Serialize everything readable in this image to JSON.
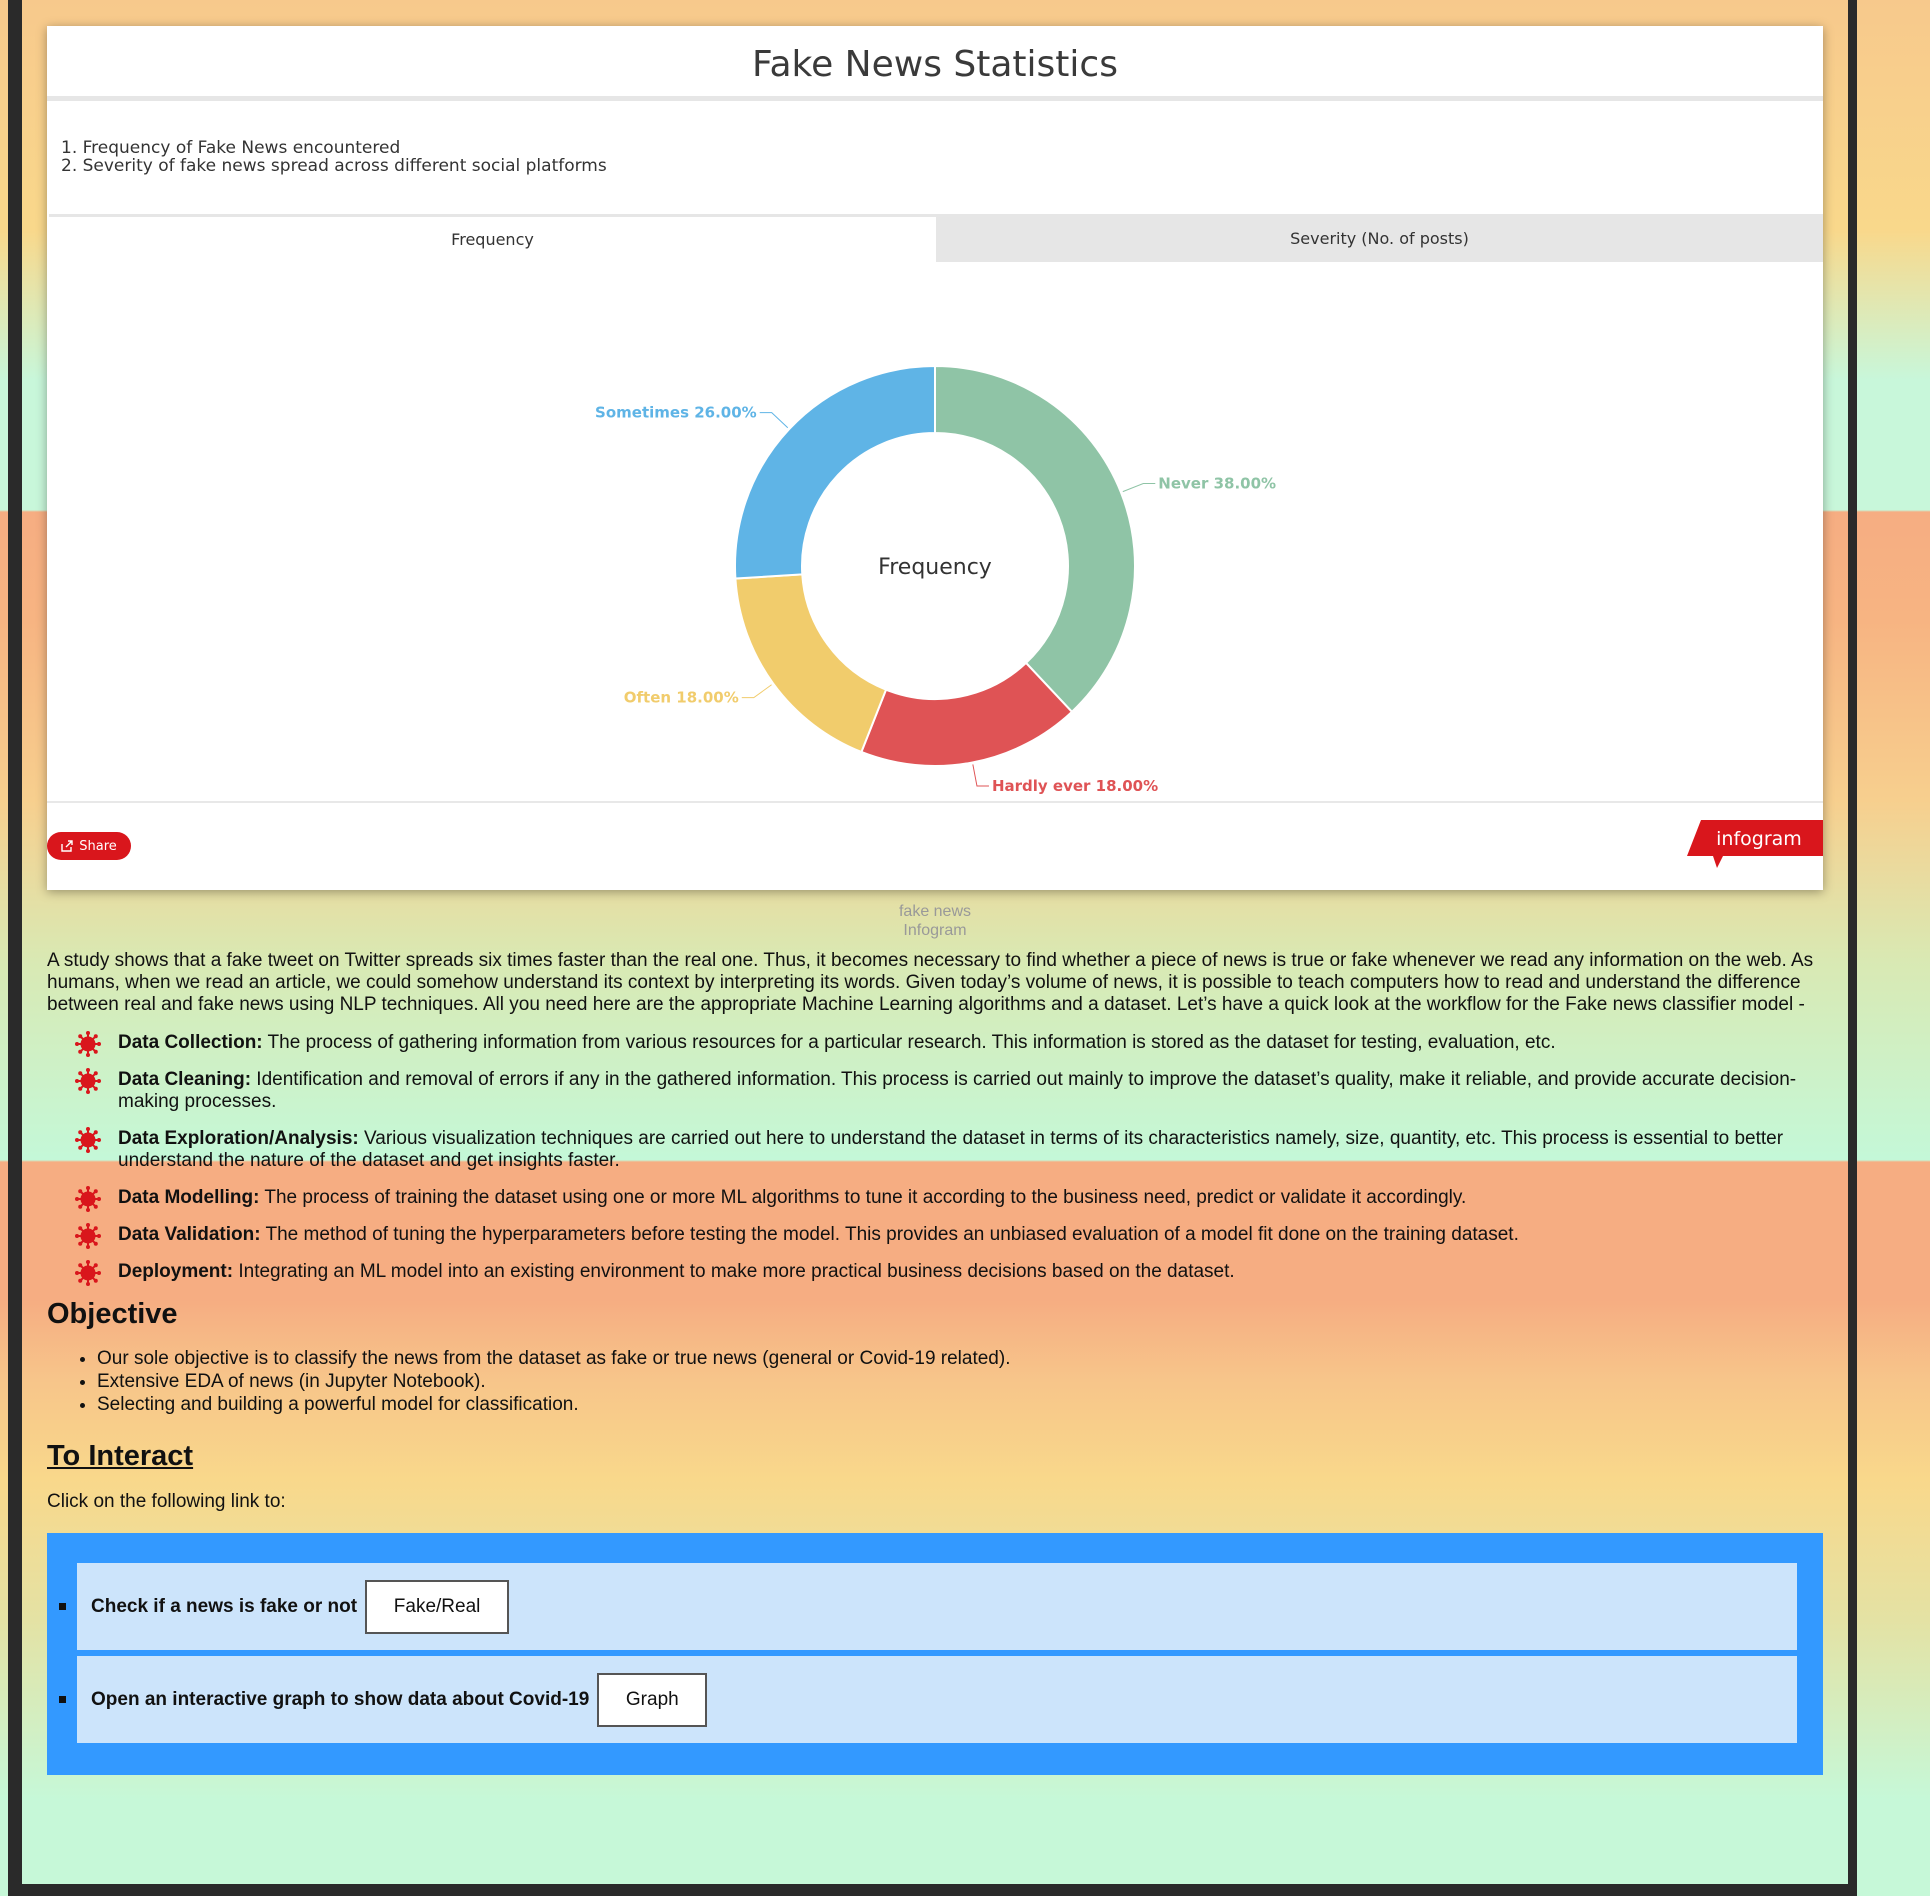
{
  "embed": {
    "title": "Fake News Statistics",
    "notes": [
      "1. Frequency of Fake News encountered",
      "2. Severity of fake news spread across different social platforms"
    ],
    "tabs": [
      "Frequency",
      "Severity (No. of posts)"
    ],
    "active_tab": "Frequency",
    "share_label": "Share",
    "brand_label": "infogram",
    "caption_line1": "fake news",
    "caption_line2": "Infogram"
  },
  "chart_data": {
    "type": "pie",
    "center_label": "Frequency",
    "slices": [
      {
        "label": "Never",
        "value": 38.0,
        "display": "Never 38.00%",
        "color": "#8fc4a6"
      },
      {
        "label": "Hardly ever",
        "value": 18.0,
        "display": "Hardly ever 18.00%",
        "color": "#df5355"
      },
      {
        "label": "Often",
        "value": 18.0,
        "display": "Often 18.00%",
        "color": "#f1cc6c"
      },
      {
        "label": "Sometimes",
        "value": 26.0,
        "display": "Sometimes 26.00%",
        "color": "#5fb4e6"
      }
    ]
  },
  "article": {
    "intro": "A study shows that a fake tweet on Twitter spreads six times faster than the real one. Thus, it becomes necessary to find whether a piece of news is true or fake whenever we read any information on the web. As humans, when we read an article, we could somehow understand its context by interpreting its words. Given today’s volume of news, it is possible to teach computers how to read and understand the difference between real and fake news using NLP techniques. All you need here are the appropriate Machine Learning algorithms and a dataset. Let’s have a quick look at the workflow for the Fake news classifier model -",
    "steps": [
      {
        "title": "Data Collection:",
        "text": " The process of gathering information from various resources for a particular research. This information is stored as the dataset for testing, evaluation, etc."
      },
      {
        "title": "Data Cleaning:",
        "text": " Identification and removal of errors if any in the gathered information. This process is carried out mainly to improve the dataset’s quality, make it reliable, and provide accurate decision-making processes."
      },
      {
        "title": "Data Exploration/Analysis:",
        "text": " Various visualization techniques are carried out here to understand the dataset in terms of its characteristics namely, size, quantity, etc. This process is essential to better understand the nature of the dataset and get insights faster."
      },
      {
        "title": "Data Modelling:",
        "text": " The process of training the dataset using one or more ML algorithms to tune it according to the business need, predict or validate it accordingly."
      },
      {
        "title": "Data Validation:",
        "text": " The method of tuning the hyperparameters before testing the model. This provides an unbiased evaluation of a model fit done on the training dataset."
      },
      {
        "title": "Deployment:",
        "text": " Integrating an ML model into an existing environment to make more practical business decisions based on the dataset."
      }
    ],
    "objective_heading": "Objective",
    "objectives": [
      "Our sole objective is to classify the news from the dataset as fake or true news (general or Covid-19 related).",
      "Extensive EDA of news (in Jupyter Notebook).",
      "Selecting and building a powerful model for classification."
    ],
    "interact_heading": "To Interact",
    "click_text": "Click on the following link to:"
  },
  "links": [
    {
      "label": "Check if a news is fake or not",
      "button": "Fake/Real"
    },
    {
      "label": "Open an interactive graph to show data about Covid-19",
      "button": "Graph"
    }
  ],
  "colors": {
    "share": "#d9161c",
    "link_panel": "#3399ff",
    "link_row": "#cce4fb",
    "virus_icon": "#d9161c"
  }
}
